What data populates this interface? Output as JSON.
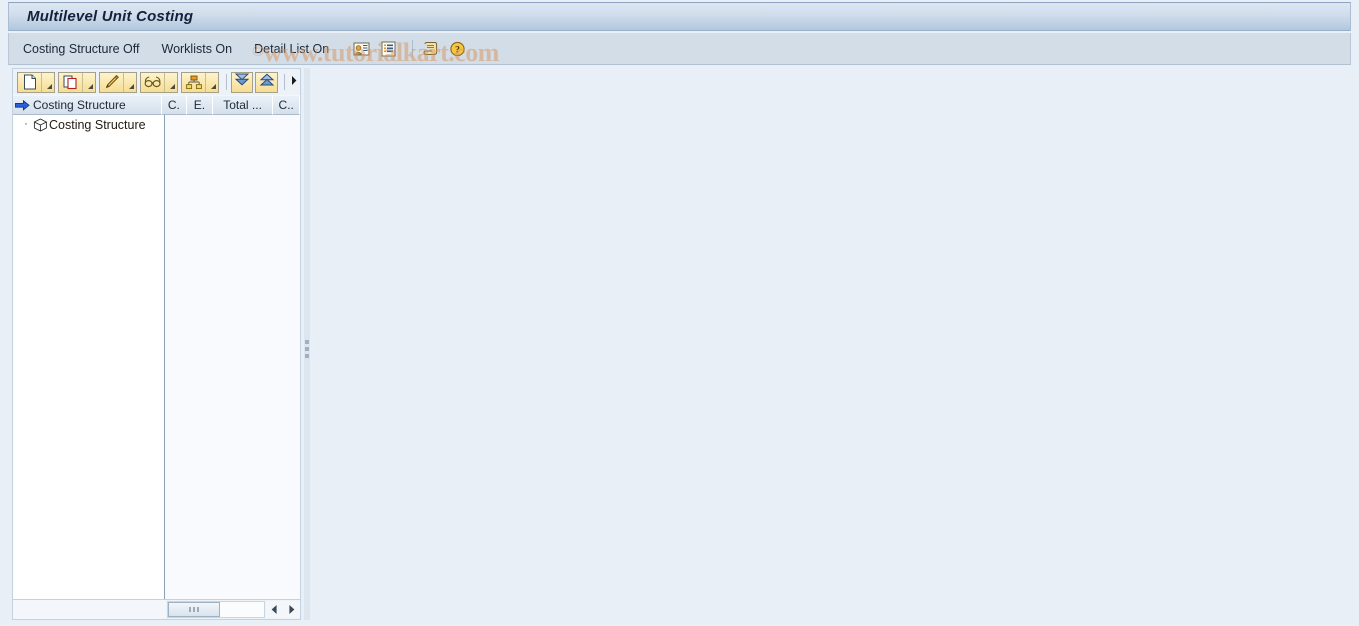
{
  "window": {
    "title": "Multilevel Unit Costing"
  },
  "menubar": {
    "items": [
      {
        "label": "Costing Structure Off",
        "name": "menu-costing-structure-off"
      },
      {
        "label": "Worklists On",
        "name": "menu-worklists-on"
      },
      {
        "label": "Detail List On",
        "name": "menu-detail-list-on"
      }
    ],
    "icons": [
      {
        "name": "person-card-icon",
        "title": "Person Card"
      },
      {
        "name": "list-document-icon",
        "title": "List Document"
      },
      {
        "name": "scroll-icon",
        "title": "Scroll"
      },
      {
        "name": "help-icon",
        "title": "Help"
      }
    ]
  },
  "watermark": {
    "text": "www.tutorialkart.com",
    "mark": "©"
  },
  "toolbar": {
    "buttons": [
      {
        "name": "create-button",
        "icon": "new-document-icon",
        "has_dropdown": true
      },
      {
        "name": "copy-button",
        "icon": "copy-icon",
        "has_dropdown": true
      },
      {
        "name": "change-button",
        "icon": "pencil-icon",
        "has_dropdown": true
      },
      {
        "name": "display-button",
        "icon": "glasses-icon",
        "has_dropdown": true
      },
      {
        "name": "structure-button",
        "icon": "hierarchy-icon",
        "has_dropdown": true
      },
      {
        "name": "expand-all-button",
        "icon": "expand-all-icon",
        "has_dropdown": false
      },
      {
        "name": "collapse-all-button",
        "icon": "collapse-all-icon",
        "has_dropdown": false
      }
    ],
    "overflow": {
      "name": "toolbar-overflow-button",
      "icon": "chevron-right-icon"
    }
  },
  "tree": {
    "columns": [
      {
        "label": "Costing Structure",
        "name": "column-costing-structure"
      },
      {
        "label": "C.",
        "name": "column-c1"
      },
      {
        "label": "E.",
        "name": "column-e"
      },
      {
        "label": "Total ...",
        "name": "column-total"
      },
      {
        "label": "C..",
        "name": "column-c2"
      }
    ],
    "header_icon": "arrow-right-icon",
    "rows": [
      {
        "label": "Costing Structure",
        "icon": "cube-icon",
        "bullet": "·"
      }
    ]
  },
  "scrollbar": {
    "left_arrow": "◀",
    "right_arrow": "▶",
    "name": "horizontal-scrollbar"
  },
  "colors": {
    "title_text": "#14213b",
    "titlebar_gradient_top": "#dde7f2",
    "titlebar_gradient_bottom": "#b2c7dd",
    "menubar_bg": "#d2dde8",
    "body_bg": "#e9eff6",
    "toolbar_button_bg": "#f7dd92",
    "watermark": "#d69661",
    "accent_blue": "#2b5fd9"
  }
}
